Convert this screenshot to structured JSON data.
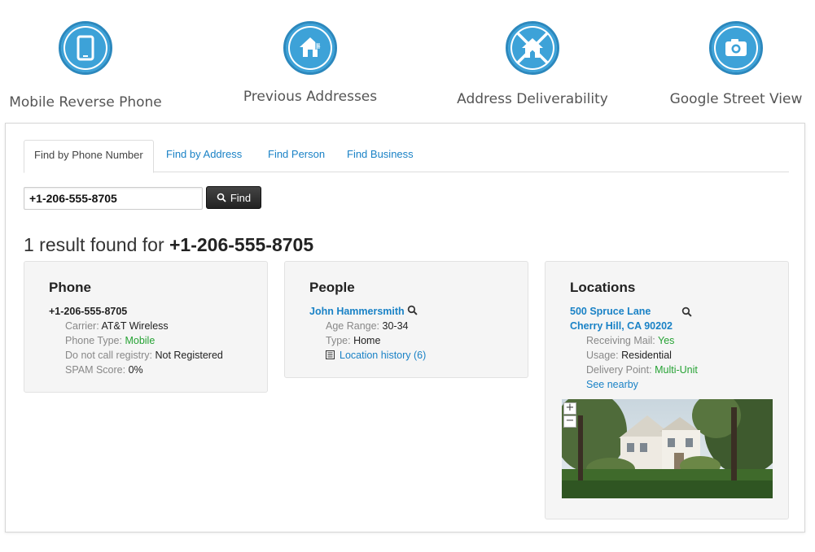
{
  "features": [
    {
      "icon": "mobile-phone-icon",
      "label": "Mobile Reverse Phone"
    },
    {
      "icon": "house-icon",
      "label": "Previous Addresses"
    },
    {
      "icon": "house-crossed-icon",
      "label": "Address Deliverability"
    },
    {
      "icon": "camera-icon",
      "label": "Google Street View"
    }
  ],
  "tabs": [
    {
      "label": "Find by Phone Number",
      "active": true
    },
    {
      "label": "Find by Address",
      "active": false
    },
    {
      "label": "Find Person",
      "active": false
    },
    {
      "label": "Find Business",
      "active": false
    }
  ],
  "search": {
    "value": "+1-206-555-8705",
    "button_label": "Find"
  },
  "result": {
    "prefix": "1 result found for",
    "query": "+1-206-555-8705"
  },
  "phone_card": {
    "title": "Phone",
    "number": "+1-206-555-8705",
    "carrier_label": "Carrier:",
    "carrier": "AT&T Wireless",
    "type_label": "Phone Type:",
    "type": "Mobile",
    "dnc_label": "Do not call registry:",
    "dnc": "Not Registered",
    "spam_label": "SPAM Score:",
    "spam": "0%"
  },
  "people_card": {
    "title": "People",
    "name": "John Hammersmith",
    "age_label": "Age Range:",
    "age": "30-34",
    "type_label": "Type:",
    "type": "Home",
    "history_link": "Location history (6)"
  },
  "locations_card": {
    "title": "Locations",
    "address_line1": "500 Spruce Lane",
    "address_line2": "Cherry Hill, CA 90202",
    "mail_label": "Receiving Mail:",
    "mail": "Yes",
    "usage_label": "Usage:",
    "usage": "Residential",
    "delivery_label": "Delivery Point:",
    "delivery": "Multi-Unit",
    "nearby_link": "See nearby",
    "zoom_in": "+",
    "zoom_out": "−"
  },
  "colors": {
    "accent": "#3da2d8",
    "link": "#1a82c6",
    "positive": "#26a234"
  }
}
